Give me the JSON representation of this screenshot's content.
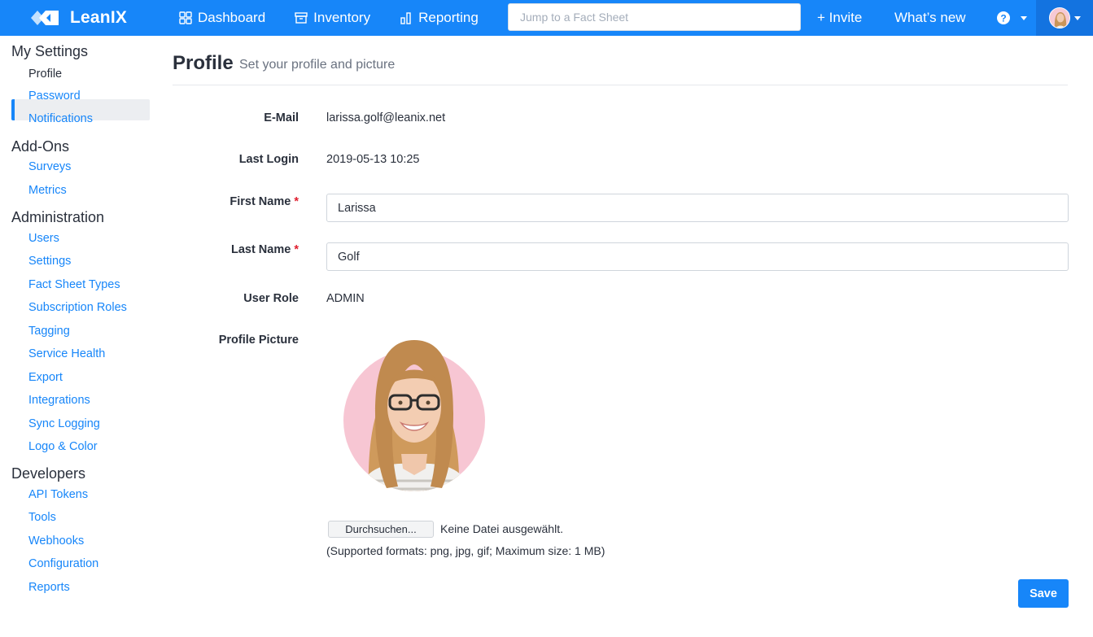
{
  "brand": {
    "name": "LeanIX"
  },
  "nav": {
    "dashboard": "Dashboard",
    "inventory": "Inventory",
    "reporting": "Reporting",
    "search_placeholder": "Jump to a Fact Sheet",
    "invite": "+ Invite",
    "whats_new": "What’s new",
    "help_icon": "question-circle-icon",
    "accent": "#1786f9"
  },
  "sidebar": {
    "sections": [
      {
        "title": "My Settings",
        "items": [
          "Profile",
          "Password",
          "Notifications"
        ]
      },
      {
        "title": "Add-Ons",
        "items": [
          "Surveys",
          "Metrics"
        ]
      },
      {
        "title": "Administration",
        "items": [
          "Users",
          "Settings",
          "Fact Sheet Types",
          "Subscription Roles",
          "Tagging",
          "Service Health",
          "Export",
          "Integrations",
          "Sync Logging",
          "Logo & Color"
        ]
      },
      {
        "title": "Developers",
        "items": [
          "API Tokens",
          "Tools",
          "Webhooks",
          "Configuration",
          "Reports"
        ]
      }
    ],
    "active_item": "Profile"
  },
  "page": {
    "title": "Profile",
    "subtitle": "Set your profile and picture"
  },
  "form": {
    "email_label": "E-Mail",
    "email_value": "larissa.golf@leanix.net",
    "last_login_label": "Last Login",
    "last_login_value": "2019-05-13 10:25",
    "first_name_label": "First Name",
    "first_name_value": "Larissa",
    "last_name_label": "Last Name",
    "last_name_value": "Golf",
    "required_mark": "*",
    "user_role_label": "User Role",
    "user_role_value": "ADMIN",
    "profile_picture_label": "Profile Picture",
    "file_button": "Durchsuchen...",
    "file_status": "Keine Datei ausgewählt.",
    "file_hint": "(Supported formats: png, jpg, gif; Maximum size: 1 MB)",
    "save_button": "Save"
  }
}
